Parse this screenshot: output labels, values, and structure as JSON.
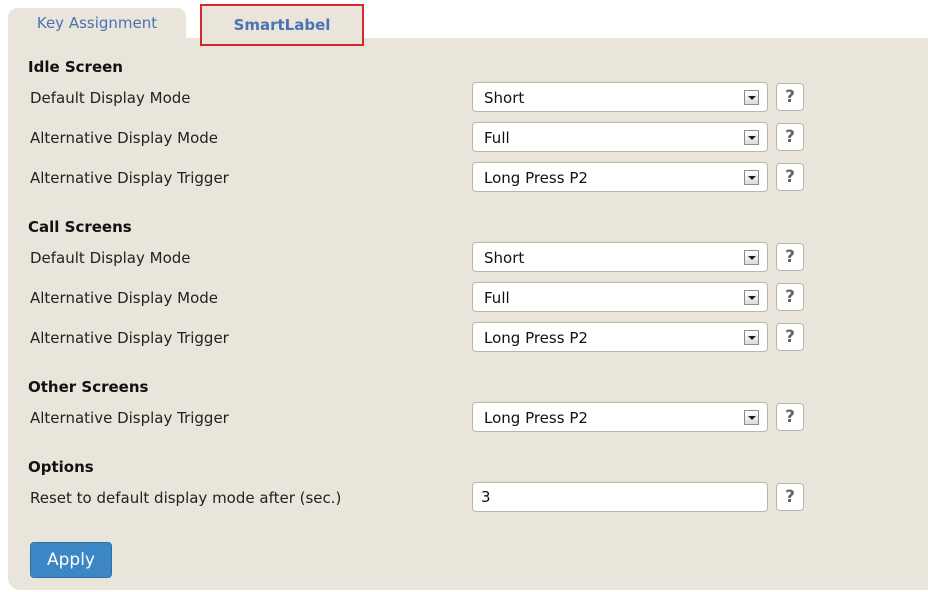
{
  "tabs": [
    {
      "label": "Key Assignment"
    },
    {
      "label": "SmartLabel"
    }
  ],
  "sections": {
    "idle": {
      "title": "Idle Screen",
      "rows": [
        {
          "label": "Default Display Mode",
          "value": "Short"
        },
        {
          "label": "Alternative Display Mode",
          "value": "Full"
        },
        {
          "label": "Alternative Display Trigger",
          "value": "Long Press P2"
        }
      ]
    },
    "call": {
      "title": "Call Screens",
      "rows": [
        {
          "label": "Default Display Mode",
          "value": "Short"
        },
        {
          "label": "Alternative Display Mode",
          "value": "Full"
        },
        {
          "label": "Alternative Display Trigger",
          "value": "Long Press P2"
        }
      ]
    },
    "other": {
      "title": "Other Screens",
      "rows": [
        {
          "label": "Alternative Display Trigger",
          "value": "Long Press P2"
        }
      ]
    },
    "options": {
      "title": "Options",
      "rows": [
        {
          "label": "Reset to default display mode after (sec.)",
          "value": "3"
        }
      ]
    }
  },
  "help_label": "?",
  "apply_label": "Apply",
  "colors": {
    "accent": "#3d86c6",
    "panel": "#e9e5db",
    "tab_highlight": "#d9262c",
    "tab_text": "#4a72b4"
  }
}
